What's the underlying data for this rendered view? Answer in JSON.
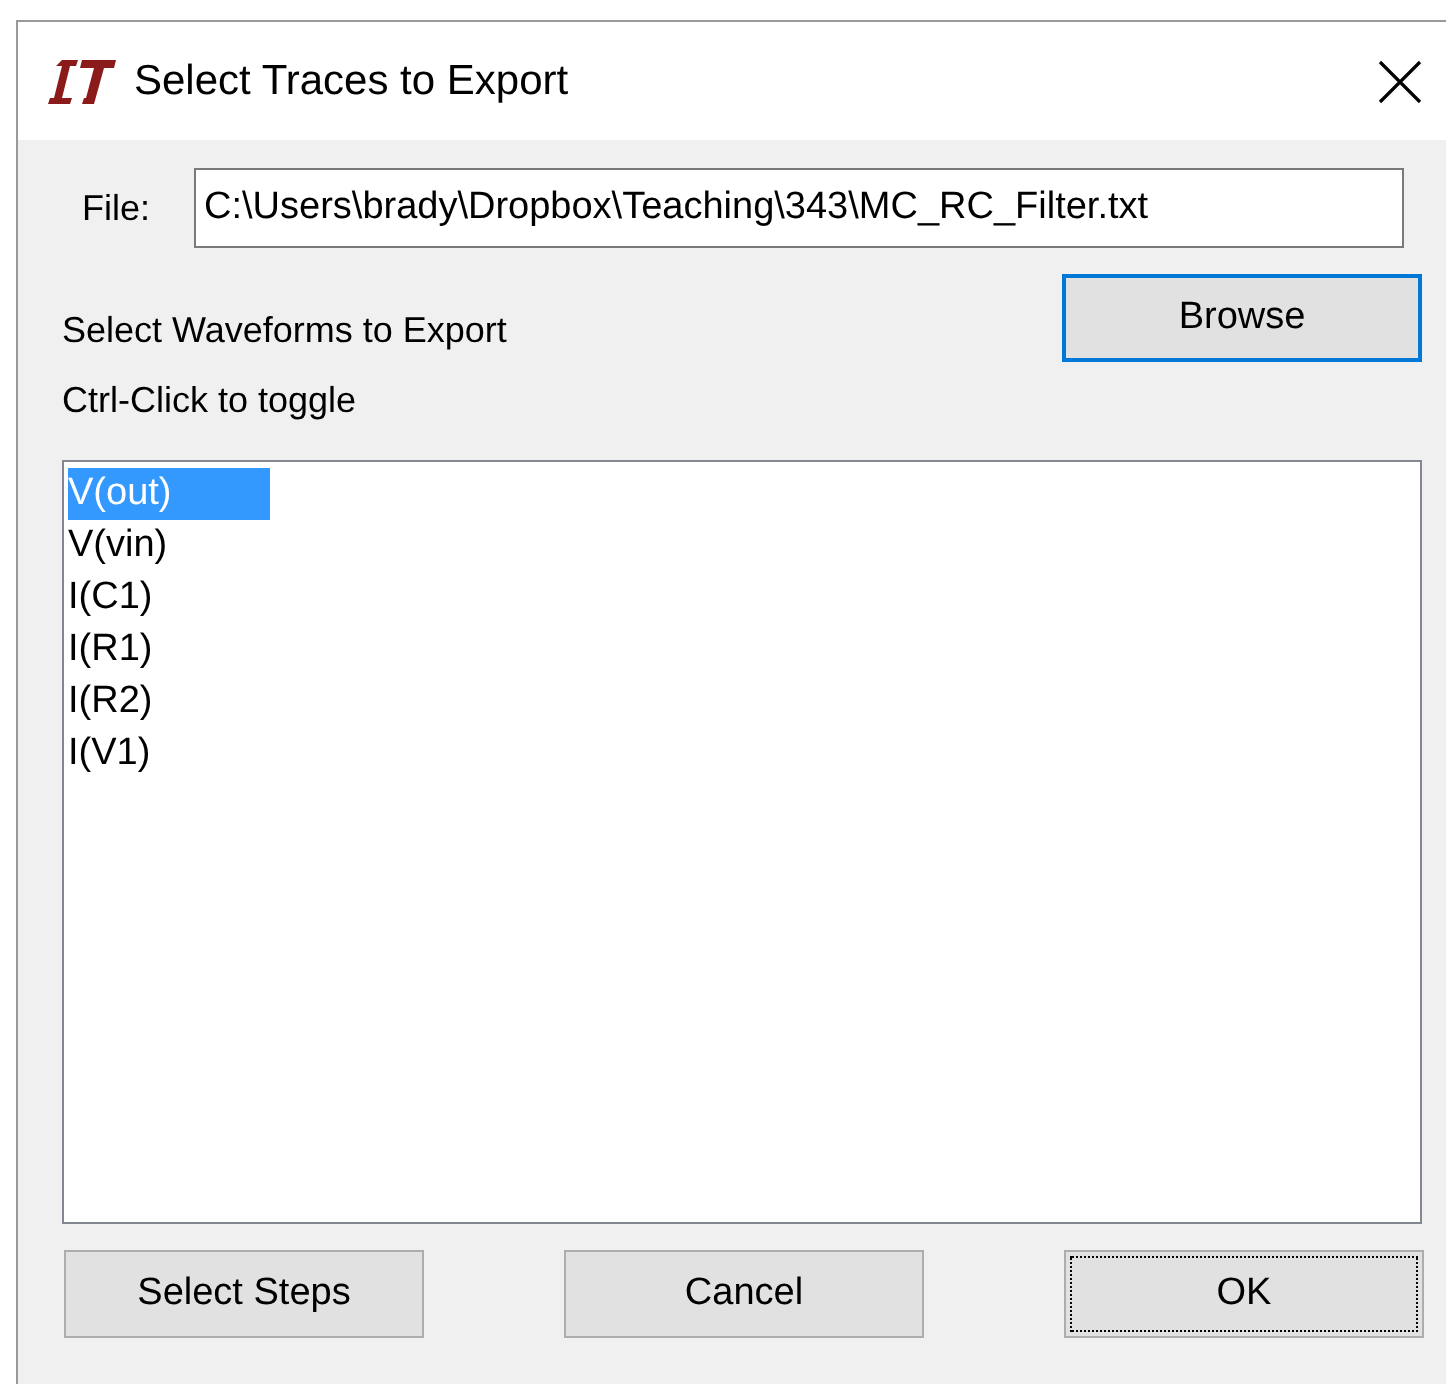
{
  "window": {
    "title": "Select Traces to Export"
  },
  "file": {
    "label": "File:",
    "value": "C:\\Users\\brady\\Dropbox\\Teaching\\343\\MC_RC_Filter.txt"
  },
  "browse_button": {
    "label": "Browse",
    "default": true
  },
  "instructions": [
    "Select Waveforms to Export",
    "Ctrl-Click to toggle"
  ],
  "waveforms": [
    {
      "label": "V(out)",
      "selected": true
    },
    {
      "label": "V(vin)",
      "selected": false
    },
    {
      "label": "I(C1)",
      "selected": false
    },
    {
      "label": "I(R1)",
      "selected": false
    },
    {
      "label": "I(R2)",
      "selected": false
    },
    {
      "label": "I(V1)",
      "selected": false
    }
  ],
  "buttons": [
    {
      "label": "Select Steps",
      "focused": false
    },
    {
      "label": "Cancel",
      "focused": false
    },
    {
      "label": "OK",
      "focused": true
    }
  ]
}
